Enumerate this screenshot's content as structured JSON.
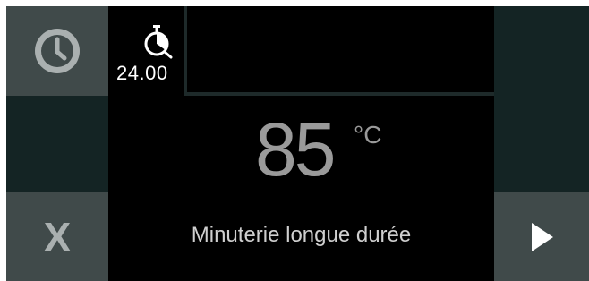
{
  "timer": {
    "icon": "kitchen-timer-icon",
    "value": "24.00"
  },
  "display": {
    "temperature": "85",
    "unit": "°C",
    "mode_label": "Minuterie longue durée"
  },
  "buttons": {
    "clock_icon": "clock-icon",
    "cancel_label": "X",
    "next_icon": "play-arrow-icon"
  },
  "colors": {
    "panel_dark": "#142424",
    "panel_gray": "#404a4a",
    "text_primary": "#ffffff",
    "temp_color": "#9a9a9a",
    "icon_gray": "#aab0b0"
  }
}
